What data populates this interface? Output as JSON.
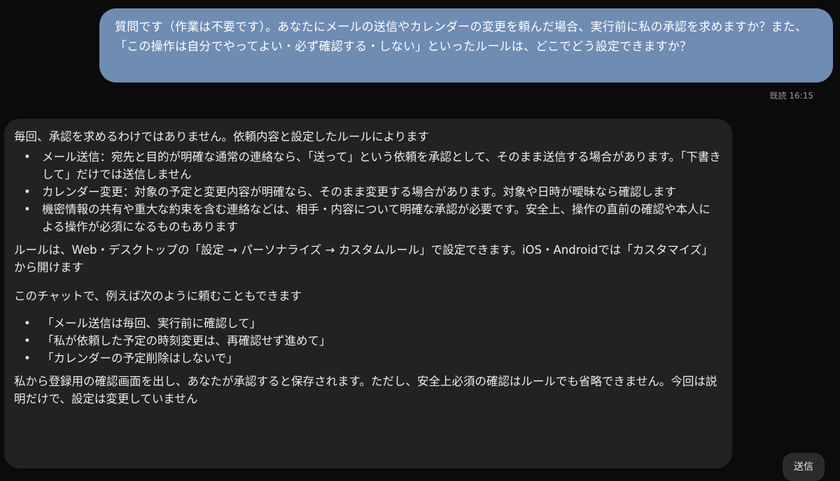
{
  "user_message": {
    "text": "質問です（作業は不要です）。あなたにメールの送信やカレンダーの変更を頼んだ場合、実行前に私の承認を求めますか？また、「この操作は自分でやってよい・必ず確認する・しない」といったルールは、どこでどう設定できますか？",
    "status": "既読 16:15"
  },
  "assistant_message": {
    "intro": "毎回、承認を求めるわけではありません。依頼内容と設定したルールによります",
    "bullets": [
      "メール送信：宛先と目的が明確な通常の連絡なら、「送って」という依頼を承認として、そのまま送信する場合があります。「下書きして」だけでは送信しません",
      "カレンダー変更：対象の予定と変更内容が明確なら、そのまま変更する場合があります。対象や日時が曖昧なら確認します",
      "機密情報の共有や重大な約束を含む連絡などは、相手・内容について明確な承認が必要です。安全上、操作の直前の確認や本人による操作が必須になるものもあります"
    ],
    "settings_text": "ルールは、Web・デスクトップの「設定 → パーソナライズ → カスタムルール」で設定できます。iOS・Androidでは「カスタマイズ」から開けます",
    "example_intro": "このチャットで、例えば次のように頼むこともできます",
    "examples": [
      "「メール送信は毎回、実行前に確認して」",
      "「私が依頼した予定の時刻変更は、再確認せず進めて」",
      "「カレンダーの予定削除はしないで」"
    ],
    "closing": "私から登録用の確認画面を出し、あなたが承認すると保存されます。ただし、安全上必須の確認はルールでも省略できません。今回は説明だけで、設定は変更していません"
  },
  "composer": {
    "send_label": "送信"
  },
  "bullet_glyph": "•"
}
